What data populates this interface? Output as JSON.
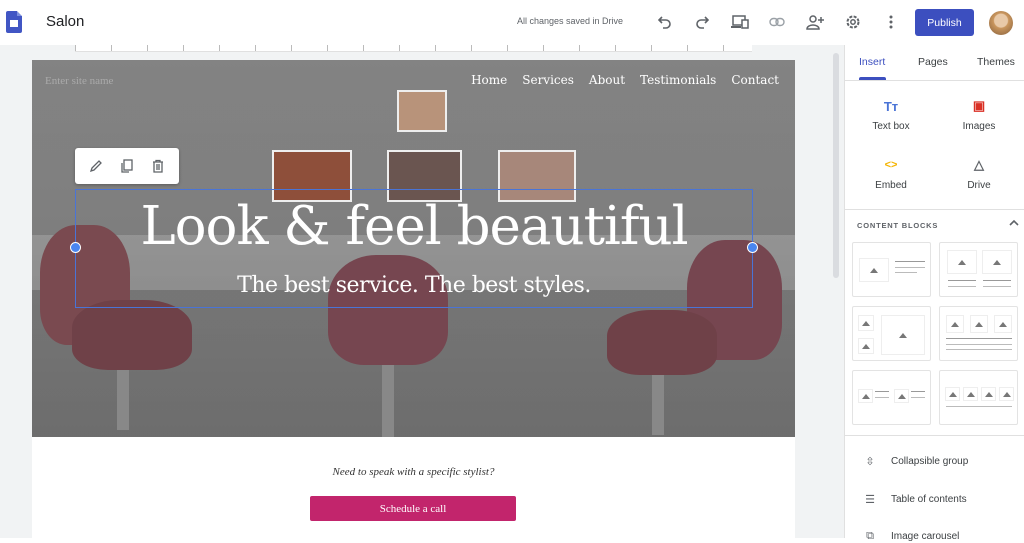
{
  "app": {
    "title": "Salon",
    "save_status": "All changes saved in Drive",
    "publish_label": "Publish",
    "toolbar_icons": [
      "undo-icon",
      "redo-icon",
      "preview-icon",
      "link-icon",
      "share-icon",
      "settings-icon",
      "more-icon"
    ]
  },
  "site": {
    "site_name_placeholder": "Enter site name",
    "nav": [
      "Home",
      "Services",
      "About",
      "Testimonials",
      "Contact"
    ],
    "headline": "Look & feel beautiful",
    "subheadline": "The best service. The best styles.",
    "edit_tools": [
      "edit-icon",
      "duplicate-icon",
      "delete-icon"
    ],
    "cta_prompt": "Need to speak with a specific stylist?",
    "cta_button": "Schedule a call"
  },
  "panel": {
    "tabs": [
      {
        "label": "Insert",
        "active": true
      },
      {
        "label": "Pages",
        "active": false
      },
      {
        "label": "Themes",
        "active": false
      }
    ],
    "insert_items": [
      {
        "label": "Text box",
        "icon": "Tт",
        "color": "#4a74d6"
      },
      {
        "label": "Images",
        "icon": "▣",
        "color": "#d93025"
      },
      {
        "label": "Embed",
        "icon": "<>",
        "color": "#f4b400"
      },
      {
        "label": "Drive",
        "icon": "△",
        "color": "#5f6368"
      }
    ],
    "content_blocks_title": "CONTENT BLOCKS",
    "list_items": [
      {
        "label": "Collapsible group",
        "icon": "⇳"
      },
      {
        "label": "Table of contents",
        "icon": "☰"
      },
      {
        "label": "Image carousel",
        "icon": "⧉"
      }
    ]
  }
}
